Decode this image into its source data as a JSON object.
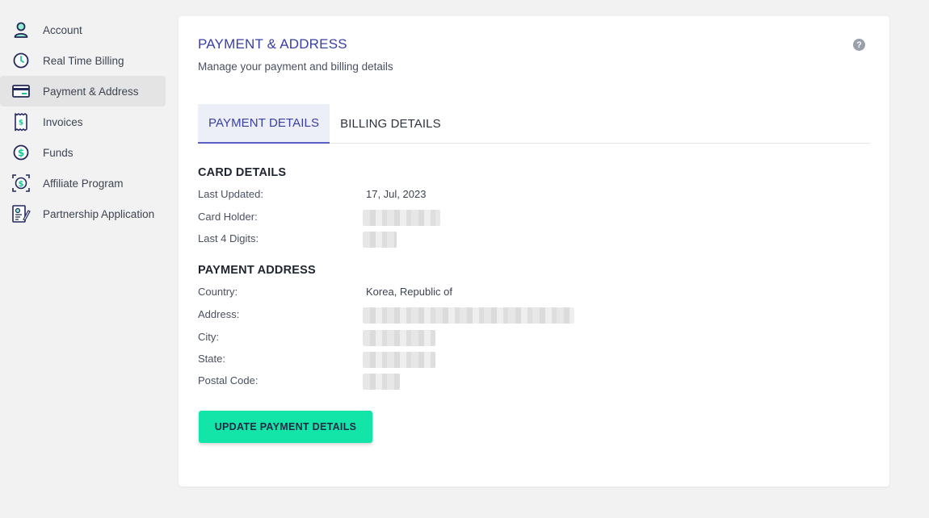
{
  "sidebar": {
    "items": [
      {
        "label": "Account",
        "icon": "user-icon"
      },
      {
        "label": "Real Time Billing",
        "icon": "clock-icon"
      },
      {
        "label": "Payment & Address",
        "icon": "credit-card-icon",
        "active": true
      },
      {
        "label": "Invoices",
        "icon": "receipt-icon"
      },
      {
        "label": "Funds",
        "icon": "dollar-coin-icon"
      },
      {
        "label": "Affiliate Program",
        "icon": "affiliate-dollar-icon"
      },
      {
        "label": "Partnership Application",
        "icon": "application-form-icon"
      }
    ]
  },
  "card": {
    "title": "PAYMENT & ADDRESS",
    "subtitle": "Manage your payment and billing details",
    "help": "?",
    "tabs": [
      {
        "label": "PAYMENT DETAILS",
        "active": true
      },
      {
        "label": "BILLING DETAILS",
        "active": false
      }
    ],
    "card_details": {
      "title": "CARD DETAILS",
      "last_updated_label": "Last Updated:",
      "last_updated_value": "17, Jul, 2023",
      "card_holder_label": "Card Holder:",
      "last4_label": "Last 4 Digits:"
    },
    "payment_address": {
      "title": "PAYMENT ADDRESS",
      "country_label": "Country:",
      "country_value": "Korea, Republic of",
      "address_label": "Address:",
      "city_label": "City:",
      "state_label": "State:",
      "postal_label": "Postal Code:"
    },
    "update_button": "UPDATE PAYMENT DETAILS"
  },
  "colors": {
    "accent": "#3a3fa3",
    "button": "#13e5a8",
    "icon_teal": "#16c79a",
    "icon_navy": "#23285a"
  }
}
